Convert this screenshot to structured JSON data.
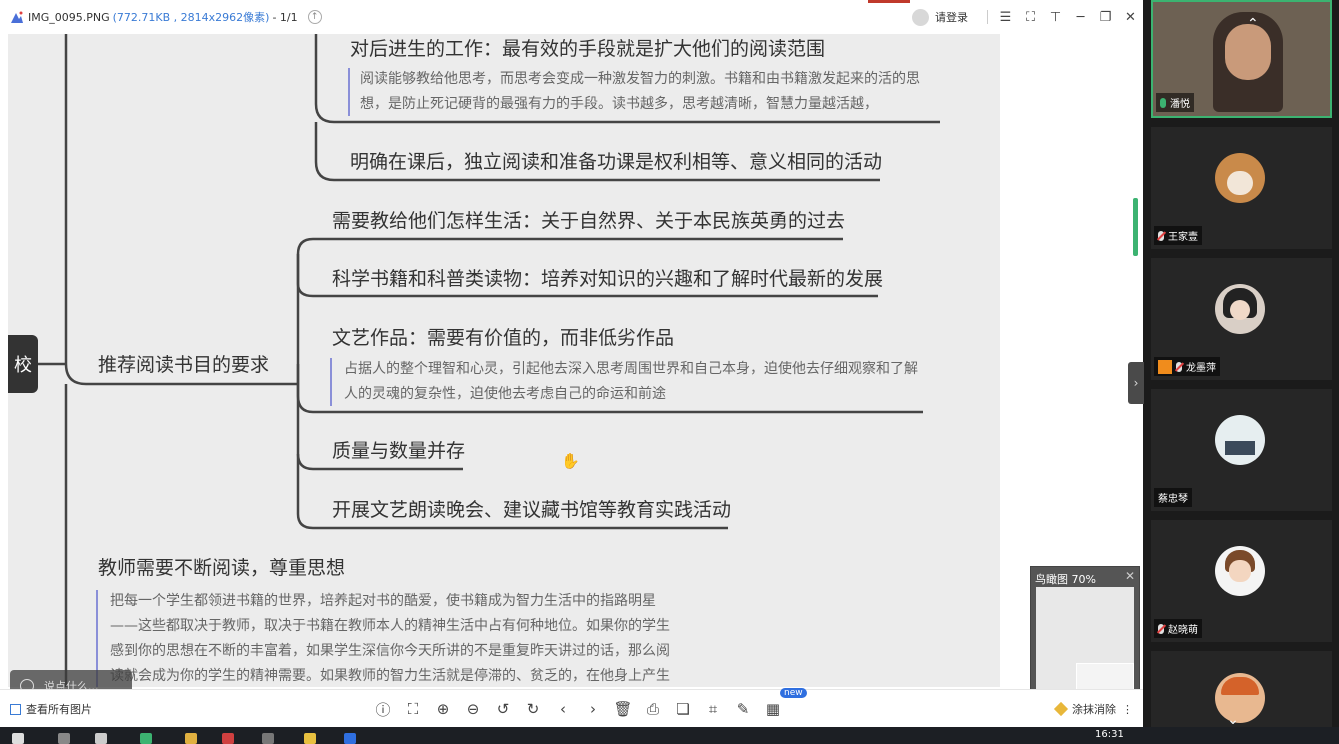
{
  "window": {
    "file_name": "IMG_0095.PNG",
    "file_meta": "(772.71KB , 2814x2962像素)",
    "page_info": "- 1/1",
    "login": "请登录"
  },
  "mindmap": {
    "upper_nodes": [
      "对后进生的工作：最有效的手段就是扩大他们的阅读范围",
      "明确在课后，独立阅读和准备功课是权利相等、意义相同的活动"
    ],
    "upper_note": "阅读能够教给他思考，而思考会变成一种激发智力的刺激。书籍和由书籍激发起来的活的思想，是防止死记硬背的最强有力的手段。读书越多，思考越清晰，智慧力量越活越，",
    "main_node": "推荐阅读书目的要求",
    "children": [
      "需要教给他们怎样生活：关于自然界、关于本民族英勇的过去",
      "科学书籍和科普类读物：培养对知识的兴趣和了解时代最新的发展",
      "文艺作品：需要有价值的，而非低劣作品",
      "质量与数量并存",
      "开展文艺朗读晚会、建议藏书馆等教育实践活动"
    ],
    "child_note": "占据人的整个理智和心灵，引起他去深入思考周围世界和自己本身，迫使他去仔细观察和了解人的灵魂的复杂性，迫使他去考虑自己的命运和前途",
    "teacher_node": "教师需要不断阅读，尊重思想",
    "teacher_note": "把每一个学生都领进书籍的世界，培养起对书的酷爱，使书籍成为智力生活中的指路明星——这些都取决于教师，取决于书籍在教师本人的精神生活中占有何种地位。如果你的学生感到你的思想在不断的丰富着，如果学生深信你今天所讲的不是重复昨天讲过的话，那么阅读就会成为你的学生的精神需要。如果教师的智力生活就是停滞的、贫乏的，在他身上产生了",
    "side_tab": "校"
  },
  "birdseye": {
    "label": "鸟瞰图 70%"
  },
  "chat": {
    "placeholder": "说点什么..."
  },
  "toolbar": {
    "all_images": "查看所有图片",
    "new_badge": "new",
    "eraser": "涂抹消除"
  },
  "taskbar": {
    "clock": "16:31"
  },
  "participants": [
    {
      "name": "潘悦",
      "mic": "on"
    },
    {
      "name": "王家壹",
      "mic": "off"
    },
    {
      "name": "龙墨萍",
      "mic": "off",
      "host": true
    },
    {
      "name": "蔡忠琴",
      "mic": "none"
    },
    {
      "name": "赵晓萌",
      "mic": "off"
    }
  ],
  "colors": {
    "accent_blue": "#3a7bd5",
    "note_bar": "#8a8fd8",
    "speaking_green": "#3cb371"
  }
}
